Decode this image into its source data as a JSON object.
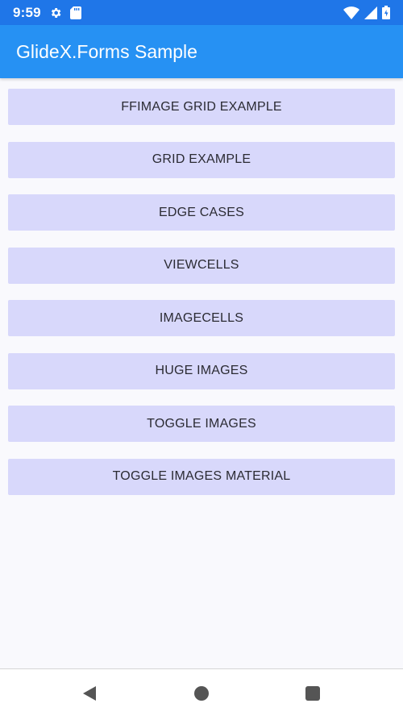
{
  "status_bar": {
    "time": "9:59",
    "left_icons": [
      "gear-icon",
      "sd-card-icon"
    ],
    "right_icons": [
      "wifi-icon",
      "signal-icon",
      "battery-icon"
    ],
    "background": "#1f76e8"
  },
  "app_bar": {
    "title": "GlideX.Forms Sample",
    "background": "#2691f3"
  },
  "menu": {
    "button_background": "#d8d8fb",
    "items": [
      {
        "label": "FFIMAGE GRID EXAMPLE"
      },
      {
        "label": "GRID EXAMPLE"
      },
      {
        "label": "EDGE CASES"
      },
      {
        "label": "VIEWCELLS"
      },
      {
        "label": "IMAGECELLS"
      },
      {
        "label": "HUGE IMAGES"
      },
      {
        "label": "TOGGLE IMAGES"
      },
      {
        "label": "TOGGLE IMAGES MATERIAL"
      }
    ]
  },
  "navigation_bar": {
    "icons": [
      "back-icon",
      "home-icon",
      "recents-icon"
    ]
  }
}
